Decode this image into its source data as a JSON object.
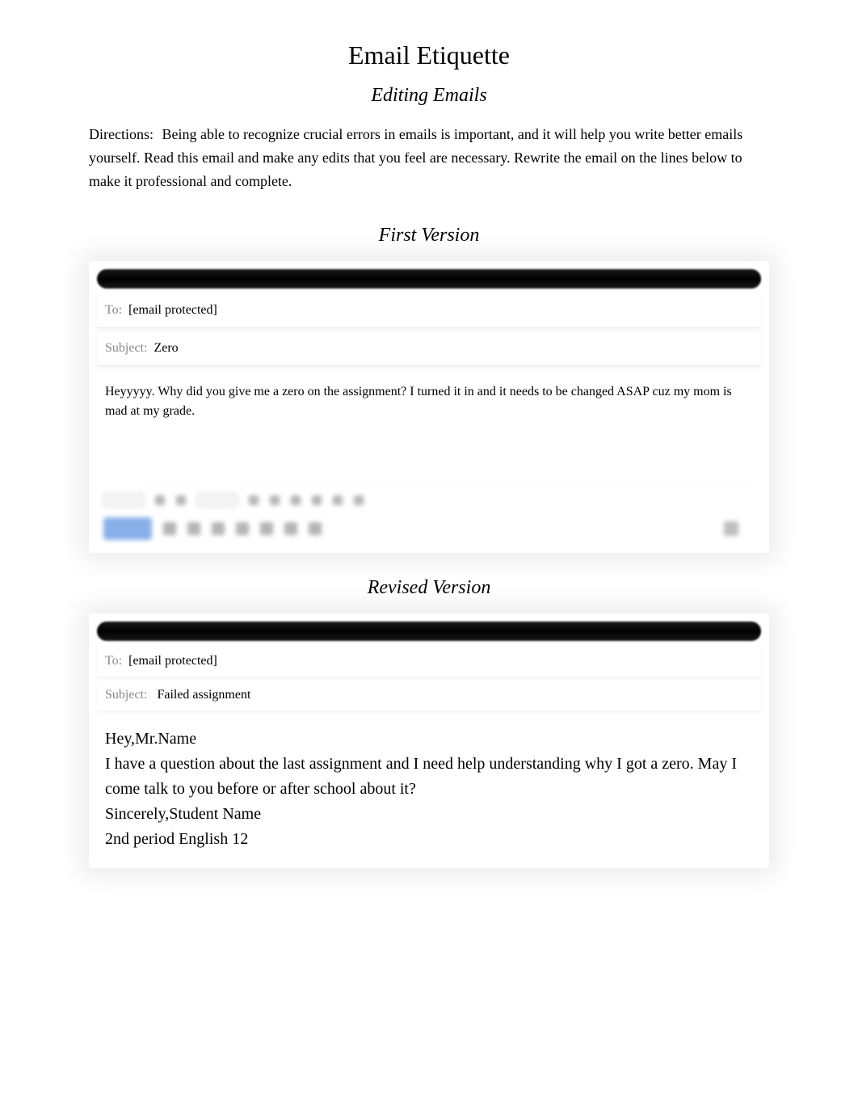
{
  "title": "Email Etiquette",
  "subtitle": "Editing Emails",
  "directions_label": "Directions:",
  "directions_text": "Being able to recognize crucial errors in emails is important, and it will help you write better emails yourself. Read this email and make any edits that you feel are necessary. Rewrite the email on the lines below to make it professional and complete.",
  "first_version": {
    "header": "First Version",
    "to_label": "To:",
    "to_value": "[email protected]",
    "subject_label": "Subject:",
    "subject_value": "Zero",
    "body": "Heyyyyy. Why did you give me a zero on the assignment? I turned it in and it needs to be changed ASAP cuz my mom is mad at my grade."
  },
  "revised_version": {
    "header": "Revised Version",
    "to_label": "To:",
    "to_value": "[email protected]",
    "subject_label": "Subject:",
    "subject_value": "Failed assignment",
    "body_greeting": "Hey,Mr.Name",
    "body_p1": "I have a question about the last assignment and I need help understanding why I got a zero. May I come talk to you before or after school about it?",
    "body_signoff": "Sincerely,Student Name",
    "body_class": "2nd period English 12"
  }
}
